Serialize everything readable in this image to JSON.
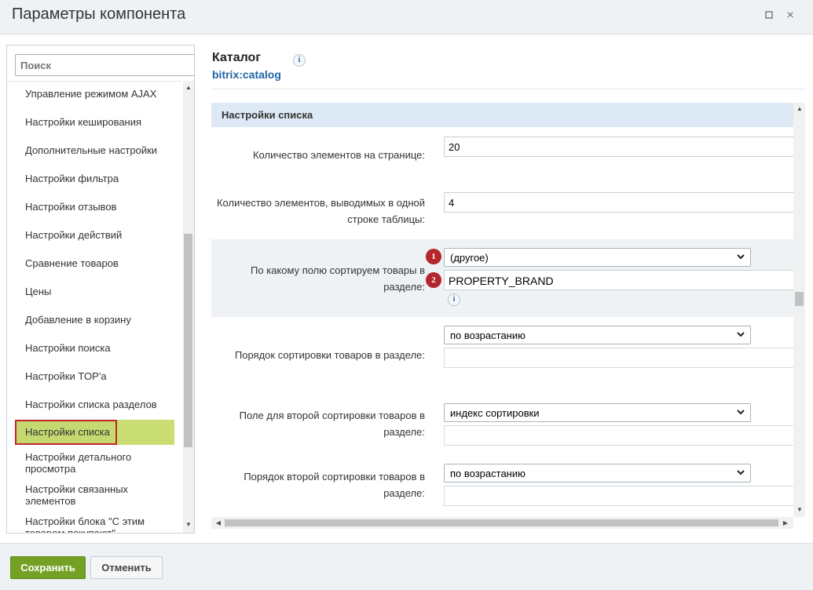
{
  "window": {
    "title": "Параметры компонента",
    "maximize_icon": "square-icon",
    "close_icon": "×"
  },
  "sidebar": {
    "search_placeholder": "Поиск",
    "items": [
      {
        "label": "Управление режимом AJAX"
      },
      {
        "label": "Настройки кеширования"
      },
      {
        "label": "Дополнительные настройки"
      },
      {
        "label": "Настройки фильтра"
      },
      {
        "label": "Настройки отзывов"
      },
      {
        "label": "Настройки действий"
      },
      {
        "label": "Сравнение товаров"
      },
      {
        "label": "Цены"
      },
      {
        "label": "Добавление в корзину"
      },
      {
        "label": "Настройки поиска"
      },
      {
        "label": "Настройки TOP'а"
      },
      {
        "label": "Настройки списка разделов"
      },
      {
        "label": "Настройки списка",
        "active": true
      },
      {
        "label": "Настройки детального просмотра"
      },
      {
        "label": "Настройки связанных элементов"
      },
      {
        "label": "Настройки блока \"С этим товаром покупают\""
      }
    ]
  },
  "component": {
    "name": "Каталог",
    "code": "bitrix:catalog",
    "info_icon": "i"
  },
  "section": {
    "title": "Настройки списка"
  },
  "fields": {
    "page_element_count": {
      "label": "Количество элементов на странице:",
      "value": "20"
    },
    "line_element_count": {
      "label": "Количество элементов, выводимых в одной строке таблицы:",
      "value": "4"
    },
    "sort_field": {
      "label": "По какому полю сортируем товары в разделе:",
      "select_value": "(другое)",
      "input_value": "PROPERTY_BRAND",
      "badge_1": "1",
      "badge_2": "2"
    },
    "sort_order": {
      "label": "Порядок сортировки товаров в разделе:",
      "select_value": "по возрастанию"
    },
    "sort_field2": {
      "label": "Поле для второй сортировки товаров в разделе:",
      "select_value": "индекс сортировки"
    },
    "sort_order2": {
      "label": "Порядок второй сортировки товаров в разделе:",
      "select_value": "по возрастанию"
    }
  },
  "footer": {
    "save_label": "Сохранить",
    "cancel_label": "Отменить"
  },
  "colors": {
    "active_item_bg": "#c9dd73",
    "active_item_border": "#c0262b",
    "section_bg": "#dde9f4",
    "save_button": "#74a125",
    "badge": "#b3262b",
    "link_blue": "#2065a8"
  }
}
